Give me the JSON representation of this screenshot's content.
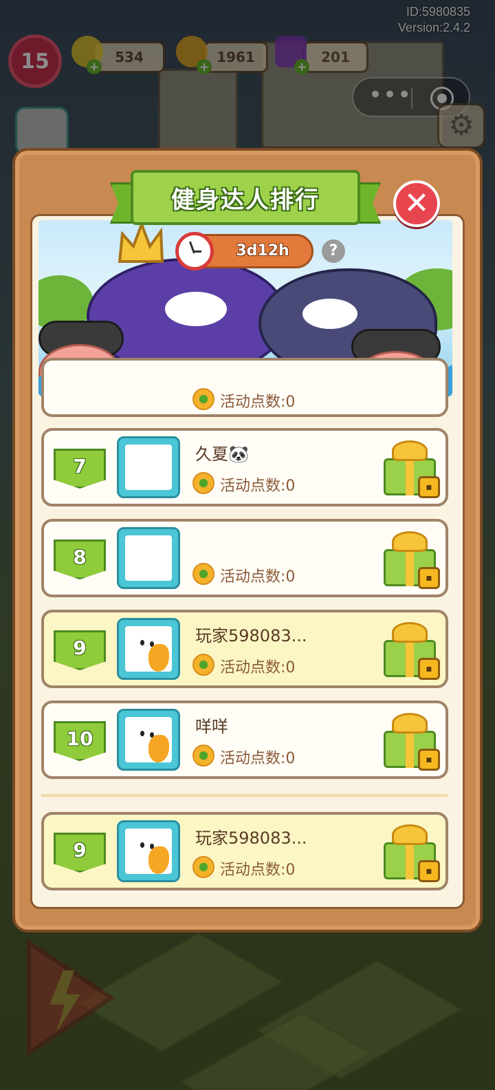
{
  "header": {
    "user_id": "ID:5980835",
    "version": "Version:2.4.2"
  },
  "hud": {
    "level": "15",
    "energy": "534",
    "coins": "1961",
    "gems": "201",
    "plus": "+"
  },
  "capsule": {
    "more_label": "•••"
  },
  "modal": {
    "title": "健身达人排行",
    "close": "✕",
    "timer": "3d12h",
    "help": "?"
  },
  "rows": [
    {
      "rank": "7",
      "name": "久夏🐼",
      "points": "活动点数:0",
      "avatar": "dog-photo",
      "highlight": false
    },
    {
      "rank": "8",
      "name": "",
      "points": "活动点数:0",
      "avatar": "bag-photo",
      "highlight": false
    },
    {
      "rank": "9",
      "name": "玩家598083...",
      "points": "活动点数:0",
      "avatar": "duck",
      "highlight": true
    },
    {
      "rank": "10",
      "name": "咩咩",
      "points": "活动点数:0",
      "avatar": "duck",
      "highlight": false
    }
  ],
  "partial_row": {
    "points": "活动点数:0"
  },
  "my_row": {
    "rank": "9",
    "name": "玩家598083...",
    "points": "活动点数:0",
    "avatar": "duck",
    "highlight": true
  },
  "colors": {
    "accent_green": "#8fcb3b",
    "panel_brown": "#c98a52",
    "close_red": "#e8464f",
    "timer_orange": "#e27a3c"
  }
}
